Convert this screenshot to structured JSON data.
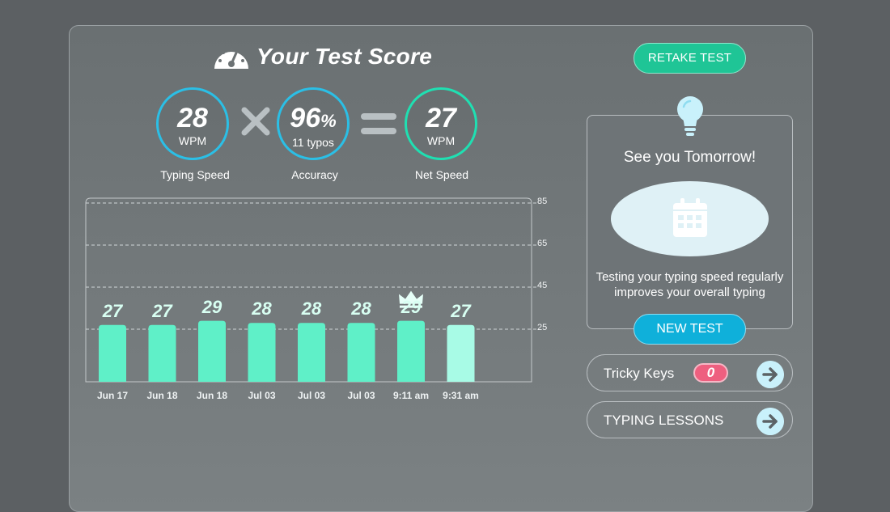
{
  "header": {
    "title": "Your Test Score",
    "icon": "speedometer-icon"
  },
  "scores": {
    "typing_speed": {
      "value": "28",
      "unit": "WPM",
      "caption": "Typing Speed"
    },
    "accuracy": {
      "value": "96",
      "suffix": "%",
      "detail": "11 typos",
      "caption": "Accuracy"
    },
    "net_speed": {
      "value": "27",
      "unit": "WPM",
      "caption": "Net Speed"
    }
  },
  "chart_data": {
    "type": "bar",
    "categories": [
      "Jun 17",
      "Jun 18",
      "Jun 18",
      "Jul 03",
      "Jul 03",
      "Jul 03",
      "9:11 am",
      "9:31 am"
    ],
    "values": [
      27,
      27,
      29,
      28,
      28,
      28,
      29,
      27
    ],
    "data_labels": [
      "27",
      "27",
      "29",
      "28",
      "28",
      "28",
      "29",
      "27"
    ],
    "ylim": [
      0,
      85
    ],
    "yticks": [
      25,
      45,
      65,
      85
    ],
    "ytick_labels": [
      "25",
      "45",
      "65",
      "85"
    ],
    "grid": true,
    "best_index": 6,
    "highlight_index": 7,
    "colors": {
      "bar": "#5ff0c8",
      "bar_latest": "#a8fbe6",
      "grid": "#d0d6d8"
    }
  },
  "buttons": {
    "retake": "RETAKE TEST",
    "new_test": "NEW TEST"
  },
  "tip": {
    "title": "See you Tomorrow!",
    "text_line1": "Testing your typing speed regularly",
    "text_line2": "improves your overall typing"
  },
  "links": {
    "tricky_keys": {
      "label": "Tricky Keys",
      "count": "0"
    },
    "typing_lessons": {
      "label": "TYPING LESSONS"
    }
  },
  "colors": {
    "accent_teal": "#1fc596",
    "accent_blue": "#0fb0da",
    "badge_pink": "#ee5f7f",
    "circle_blue": "#2bbfe6",
    "circle_green": "#1fe0b2"
  }
}
